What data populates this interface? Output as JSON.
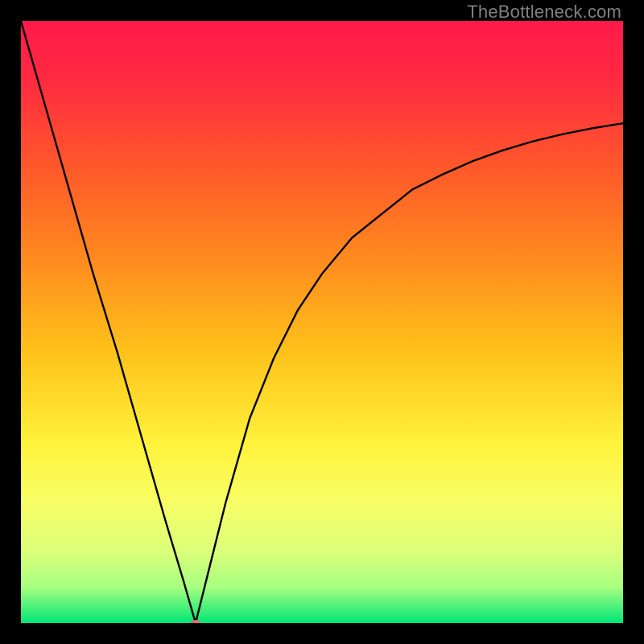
{
  "watermark": {
    "text": "TheBottleneck.com"
  },
  "chart_data": {
    "type": "line",
    "title": "",
    "xlabel": "",
    "ylabel": "",
    "xlim": [
      0,
      100
    ],
    "ylim": [
      0,
      100
    ],
    "grid": false,
    "gradient_stops": [
      {
        "offset": 0.0,
        "color": "#ff1a4a"
      },
      {
        "offset": 0.1,
        "color": "#ff2b40"
      },
      {
        "offset": 0.25,
        "color": "#ff5a2a"
      },
      {
        "offset": 0.4,
        "color": "#ff8c1e"
      },
      {
        "offset": 0.55,
        "color": "#ffc21a"
      },
      {
        "offset": 0.7,
        "color": "#fff23a"
      },
      {
        "offset": 0.8,
        "color": "#f8ff66"
      },
      {
        "offset": 0.88,
        "color": "#dcff7a"
      },
      {
        "offset": 0.94,
        "color": "#a8ff80"
      },
      {
        "offset": 1.0,
        "color": "#00e676"
      }
    ],
    "curve": {
      "comment": "V-shaped bottleneck curve: y = 100 at x=0, dips to 0 near x≈29, rises asymptotically toward ~83 at x=100",
      "x": [
        0,
        4,
        8,
        12,
        16,
        20,
        24,
        27,
        29,
        31,
        34,
        38,
        42,
        46,
        50,
        55,
        60,
        65,
        70,
        75,
        80,
        85,
        90,
        95,
        100
      ],
      "y": [
        100,
        86,
        72,
        58,
        45,
        31,
        17,
        7,
        0,
        8,
        20,
        34,
        44,
        52,
        58,
        64,
        68,
        72,
        74.5,
        76.7,
        78.5,
        80,
        81.2,
        82.2,
        83
      ]
    },
    "marker": {
      "x": 29,
      "y": 0,
      "rx": 6,
      "ry": 4,
      "fill": "#d66b6b"
    }
  }
}
